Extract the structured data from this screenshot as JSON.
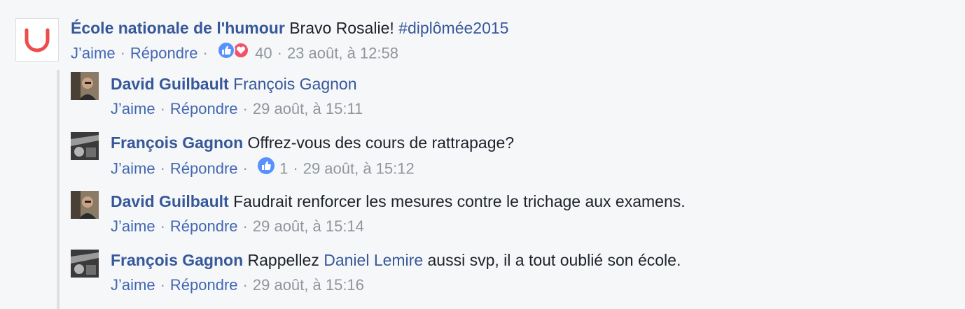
{
  "comments": [
    {
      "author": "École nationale de l'humour",
      "text": "Bravo Rosalie!",
      "hashtag": "#diplômée2015",
      "like_label": "J’aime",
      "reply_label": "Répondre",
      "reaction_count": "40",
      "timestamp": "23 août, à 12:58",
      "reactions": [
        "like-icon",
        "love-icon"
      ]
    }
  ],
  "replies": [
    {
      "author": "David Guilbault",
      "mention": "François Gagnon",
      "like_label": "J’aime",
      "reply_label": "Répondre",
      "timestamp": "29 août, à 15:11"
    },
    {
      "author": "François Gagnon",
      "text": "Offrez-vous des cours de rattrapage?",
      "like_label": "J’aime",
      "reply_label": "Répondre",
      "reaction_count": "1",
      "timestamp": "29 août, à 15:12"
    },
    {
      "author": "David Guilbault",
      "text": "Faudrait renforcer les mesures contre le trichage aux examens.",
      "like_label": "J’aime",
      "reply_label": "Répondre",
      "timestamp": "29 août, à 15:14"
    },
    {
      "author": "François Gagnon",
      "text_before": "Rappellez",
      "mention": "Daniel Lemire",
      "text_after": "aussi svp, il a tout oublié son école.",
      "like_label": "J’aime",
      "reply_label": "Répondre",
      "timestamp": "29 août, à 15:16"
    }
  ],
  "separator": "·",
  "colors": {
    "link": "#365899",
    "action": "#4267b2",
    "meta": "#90949c",
    "like": "#5890ff",
    "love": "#f25268",
    "logo": "#ee4b4b"
  }
}
